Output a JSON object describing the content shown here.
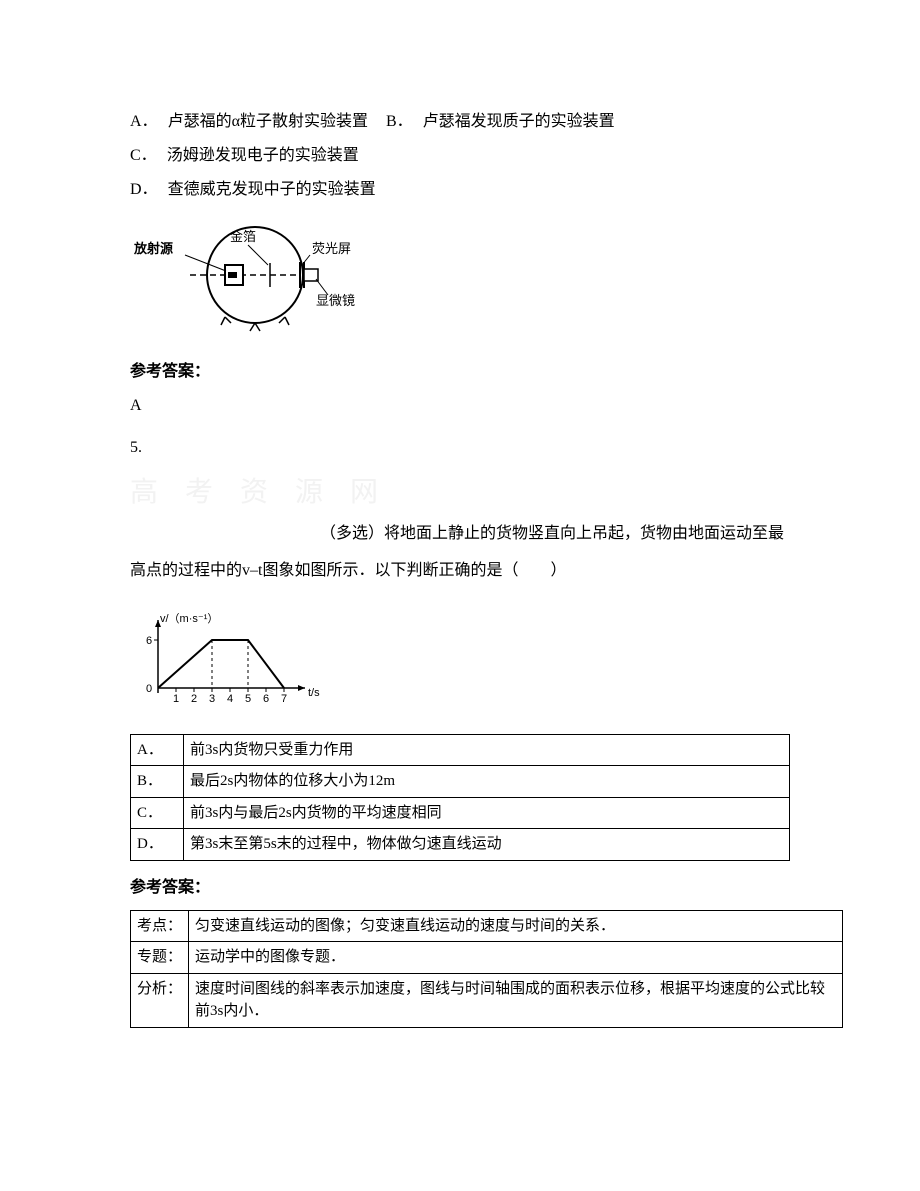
{
  "q4": {
    "optionA_label": "A．",
    "optionA_text": "卢瑟福的α粒子散射实验装置",
    "optionB_label": "B．",
    "optionB_text": "卢瑟福发现质子的实验装置",
    "optionC_label": " C．",
    "optionC_text": "汤姆逊发现电子的实验装置",
    "optionD_label": "D．",
    "optionD_text": "查德威克发现中子的实验装置",
    "diagram": {
      "source": "放射源",
      "foil": "金箔",
      "screen": "荧光屏",
      "microscope": "显微镜"
    },
    "answer_label": "参考答案：",
    "answer": "A"
  },
  "q5": {
    "number": "5.",
    "watermark": "高 考 资 源 网",
    "multi_label": "（多选）",
    "text_part1": "将地面上静止的货物竖直向上吊起，货物由地面运动至最高点的过程中的v–t图象如图所示．以下判断正确的是（　　）",
    "options": [
      {
        "label": "A．",
        "text": "前3s内货物只受重力作用"
      },
      {
        "label": "B．",
        "text": "最后2s内物体的位移大小为12m"
      },
      {
        "label": "C．",
        "text": "前3s内与最后2s内货物的平均速度相同"
      },
      {
        "label": "D．",
        "text": "第3s末至第5s末的过程中，物体做匀速直线运动"
      }
    ],
    "answer_label": "参考答案：",
    "analysis": [
      {
        "label": "考点：",
        "text": "匀变速直线运动的图像；匀变速直线运动的速度与时间的关系．"
      },
      {
        "label": "专题：",
        "text": "运动学中的图像专题．"
      },
      {
        "label": "分析：",
        "text": "速度时间图线的斜率表示加速度，图线与时间轴围成的面积表示位移，根据平均速度的公式比较前3s内小．"
      }
    ]
  },
  "chart_data": {
    "type": "line",
    "title": "",
    "xlabel": "t/s",
    "ylabel": "v/（m·s⁻¹）",
    "x": [
      0,
      1,
      2,
      3,
      4,
      5,
      6,
      7
    ],
    "y": [
      0,
      2,
      4,
      6,
      6,
      6,
      3,
      0
    ],
    "xlim": [
      0,
      7.5
    ],
    "ylim": [
      0,
      6.5
    ],
    "xticks": [
      1,
      2,
      3,
      4,
      5,
      6,
      7
    ],
    "yticks": [
      0,
      6
    ],
    "dashed_verticals_at_x": [
      3,
      5
    ]
  }
}
